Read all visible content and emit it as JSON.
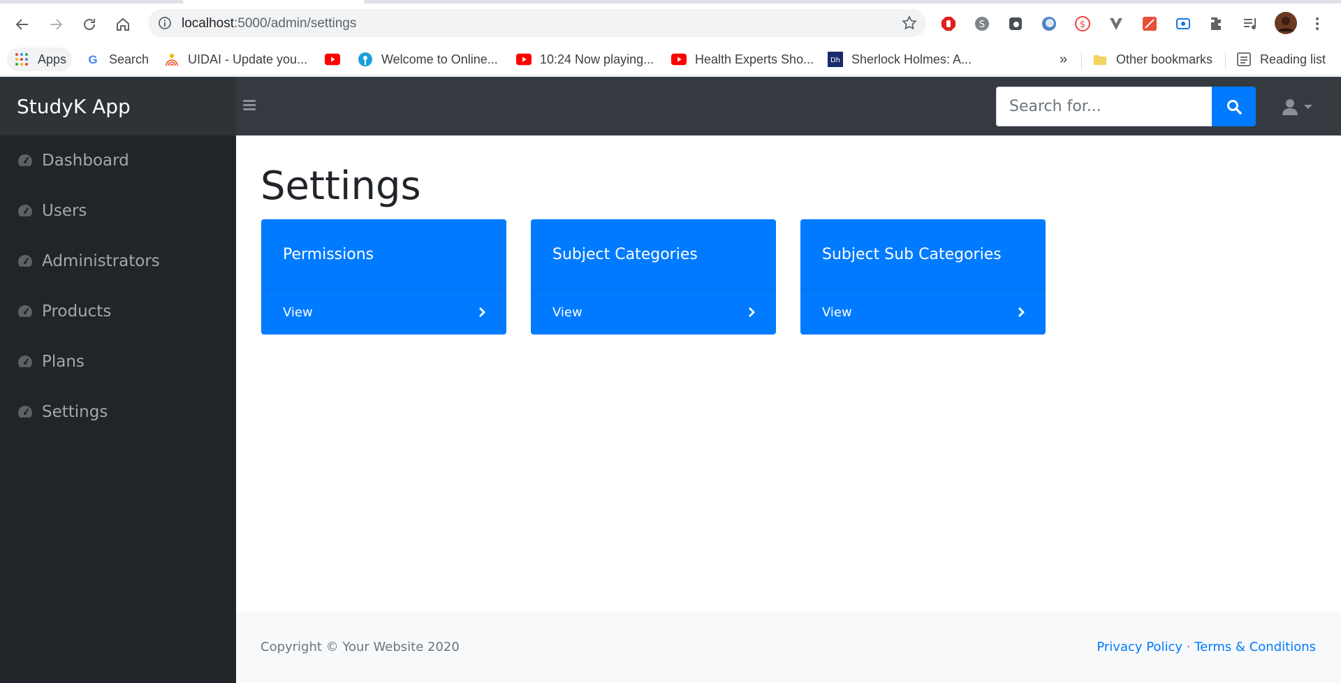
{
  "browser": {
    "url_host": "localhost",
    "url_path": ":5000/admin/settings",
    "bookmarks": [
      {
        "label": "Apps",
        "icon": "apps-grid-icon"
      },
      {
        "label": "Search",
        "icon": "google-icon"
      },
      {
        "label": "UIDAI - Update you...",
        "icon": "uidai-icon"
      },
      {
        "label": "",
        "icon": "youtube-icon"
      },
      {
        "label": "Welcome to Online...",
        "icon": "sbi-icon"
      },
      {
        "label": "10:24 Now playing...",
        "icon": "youtube-icon"
      },
      {
        "label": "Health Experts Sho...",
        "icon": "youtube-icon"
      },
      {
        "label": "Sherlock Holmes: A...",
        "icon": "dh-icon"
      }
    ],
    "overflow_label": "»",
    "other_bookmarks": "Other bookmarks",
    "reading_list": "Reading list"
  },
  "navbar": {
    "brand": "StudyK App",
    "search_placeholder": "Search for..."
  },
  "sidebar": {
    "items": [
      {
        "label": "Dashboard",
        "icon": "tachometer-icon"
      },
      {
        "label": "Users",
        "icon": "tachometer-icon"
      },
      {
        "label": "Administrators",
        "icon": "tachometer-icon"
      },
      {
        "label": "Products",
        "icon": "tachometer-icon"
      },
      {
        "label": "Plans",
        "icon": "tachometer-icon"
      },
      {
        "label": "Settings",
        "icon": "tachometer-icon"
      }
    ]
  },
  "main": {
    "title": "Settings",
    "cards": [
      {
        "title": "Permissions",
        "link": "View"
      },
      {
        "title": "Subject Categories",
        "link": "View"
      },
      {
        "title": "Subject Sub Categories",
        "link": "View"
      }
    ]
  },
  "footer": {
    "copyright": "Copyright © Your Website 2020",
    "privacy": "Privacy Policy",
    "separator": "·",
    "terms": "Terms & Conditions"
  },
  "colors": {
    "primary": "#007bff",
    "navbar": "#343a40",
    "sidebar": "#212529",
    "footer_bg": "#f8f9fa"
  }
}
